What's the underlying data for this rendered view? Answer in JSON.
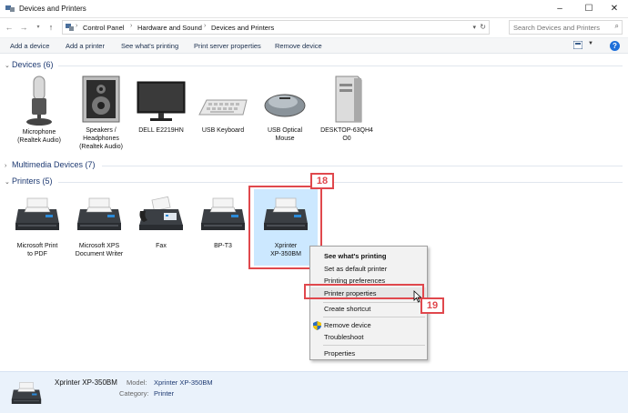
{
  "window": {
    "title": "Devices and Printers",
    "minimize": "–",
    "maximize": "☐",
    "close": "✕"
  },
  "address": {
    "crumbs": [
      "Control Panel",
      "Hardware and Sound",
      "Devices and Printers"
    ],
    "search_placeholder": "Search Devices and Printers"
  },
  "toolbar": {
    "items": [
      "Add a device",
      "Add a printer",
      "See what's printing",
      "Print server properties",
      "Remove device"
    ],
    "help": "?"
  },
  "groups": {
    "devices": "Devices (6)",
    "multimedia": "Multimedia Devices (7)",
    "printers": "Printers (5)"
  },
  "devices": [
    {
      "label": "Microphone\n(Realtek Audio)",
      "icon": "microphone-icon"
    },
    {
      "label": "Speakers /\nHeadphones\n(Realtek Audio)",
      "icon": "speaker-icon"
    },
    {
      "label": "DELL E2219HN",
      "icon": "monitor-icon"
    },
    {
      "label": "USB Keyboard",
      "icon": "keyboard-icon"
    },
    {
      "label": "USB Optical\nMouse",
      "icon": "mouse-icon"
    },
    {
      "label": "DESKTOP-63QH4\nO0",
      "icon": "computer-icon"
    }
  ],
  "printers": [
    {
      "label": "Microsoft Print\nto PDF",
      "icon": "printer-icon"
    },
    {
      "label": "Microsoft XPS\nDocument Writer",
      "icon": "printer-icon"
    },
    {
      "label": "Fax",
      "icon": "fax-icon"
    },
    {
      "label": "BP-T3",
      "icon": "printer-icon"
    },
    {
      "label": "Xprinter\nXP-350BM",
      "icon": "printer-icon"
    }
  ],
  "callouts": {
    "step1": "18",
    "step2": "19"
  },
  "context_menu": {
    "items": [
      "See what's printing",
      "Set as default printer",
      "Printing preferences",
      "Printer properties",
      "Create shortcut",
      "Remove device",
      "Troubleshoot",
      "Properties"
    ]
  },
  "details": {
    "name": "Xprinter XP-350BM",
    "model_label": "Model:",
    "model_value": "Xprinter XP-350BM",
    "category_label": "Category:",
    "category_value": "Printer"
  },
  "colors": {
    "accent": "#e0484d",
    "selection": "#cce8ff",
    "link": "#1e3a72"
  }
}
